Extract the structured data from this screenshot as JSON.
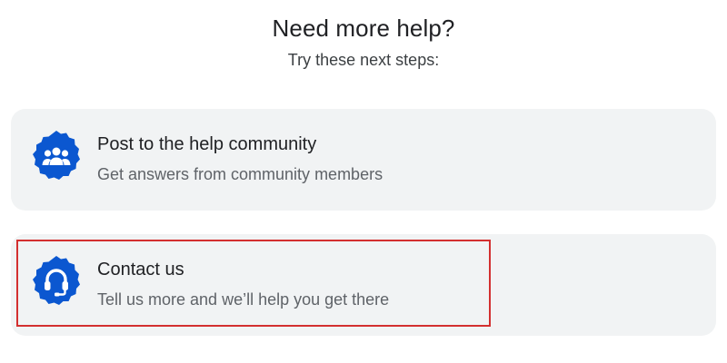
{
  "header": {
    "title": "Need more help?",
    "subtitle": "Try these next steps:"
  },
  "options": [
    {
      "title": "Post to the help community",
      "description": "Get answers from community members",
      "icon": "community-icon"
    },
    {
      "title": "Contact us",
      "description": "Tell us more and we’ll help you get there",
      "icon": "headset-icon"
    }
  ],
  "colors": {
    "accent": "#0b57d0",
    "card_background": "#f1f3f4",
    "highlight": "#d32f2f"
  }
}
